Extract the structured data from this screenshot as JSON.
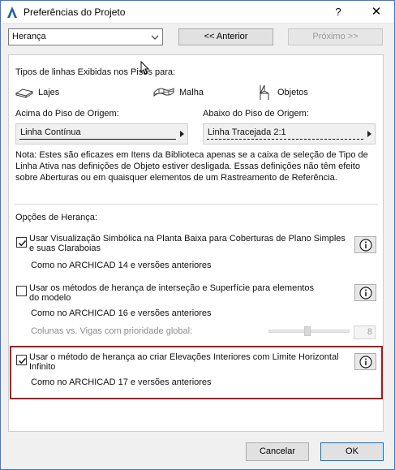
{
  "window": {
    "title": "Preferências do Projeto",
    "help_label": "?",
    "close_label": "✕"
  },
  "toolbar": {
    "select_value": "Herança",
    "prev_label": "<< Anterior",
    "next_label": "Próximo >>"
  },
  "line_types": {
    "heading": "Tipos de linhas Exibidas nos Pisos para:",
    "elements": [
      {
        "label": "Lajes",
        "icon": "slab-icon"
      },
      {
        "label": "Malha",
        "icon": "mesh-icon"
      },
      {
        "label": "Objetos",
        "icon": "chair-icon"
      }
    ],
    "above_label": "Acima do Piso de Origem:",
    "above_value": "Linha Contínua",
    "below_label": "Abaixo do Piso de Origem:",
    "below_value": "Linha Tracejada 2:1",
    "note_lines": [
      "Nota: Estes são eficazes em Itens da Biblioteca apenas se a caixa de seleção de Tipo de",
      "Linha Ativa nas definições de Objeto estiver desligada. Essas definições não têm efeito",
      "sobre Aberturas ou em quaisquer elementos de um Rastreamento de Referência."
    ]
  },
  "inheritance": {
    "heading": "Opções de Herança:",
    "option1": {
      "lines": [
        "Usar Visualização Simbólica na Planta Baixa para Coberturas de Plano Simples",
        "e suas Claraboias"
      ],
      "note": "Como no ARCHICAD 14 e versões anteriores",
      "checked": true
    },
    "option2": {
      "lines": [
        "Usar os métodos de herança de interseção e Superfície para elementos",
        "do modelo"
      ],
      "note": "Como no ARCHICAD 16 e versões anteriores",
      "checked": false,
      "sub_label": "Colunas vs. Vigas com prioridade global:",
      "sub_value": "8"
    },
    "option3": {
      "lines": [
        "Usar o método de herança ao criar Elevações Interiores com Limite Horizontal",
        "Infinito"
      ],
      "note": "Como no ARCHICAD 17 e versões anteriores",
      "checked": true
    }
  },
  "footer": {
    "cancel_label": "Cancelar",
    "ok_label": "OK"
  },
  "colors": {
    "highlight": "#b0141c",
    "ok_border": "#0078d7",
    "title_border": "#3c78c8"
  }
}
